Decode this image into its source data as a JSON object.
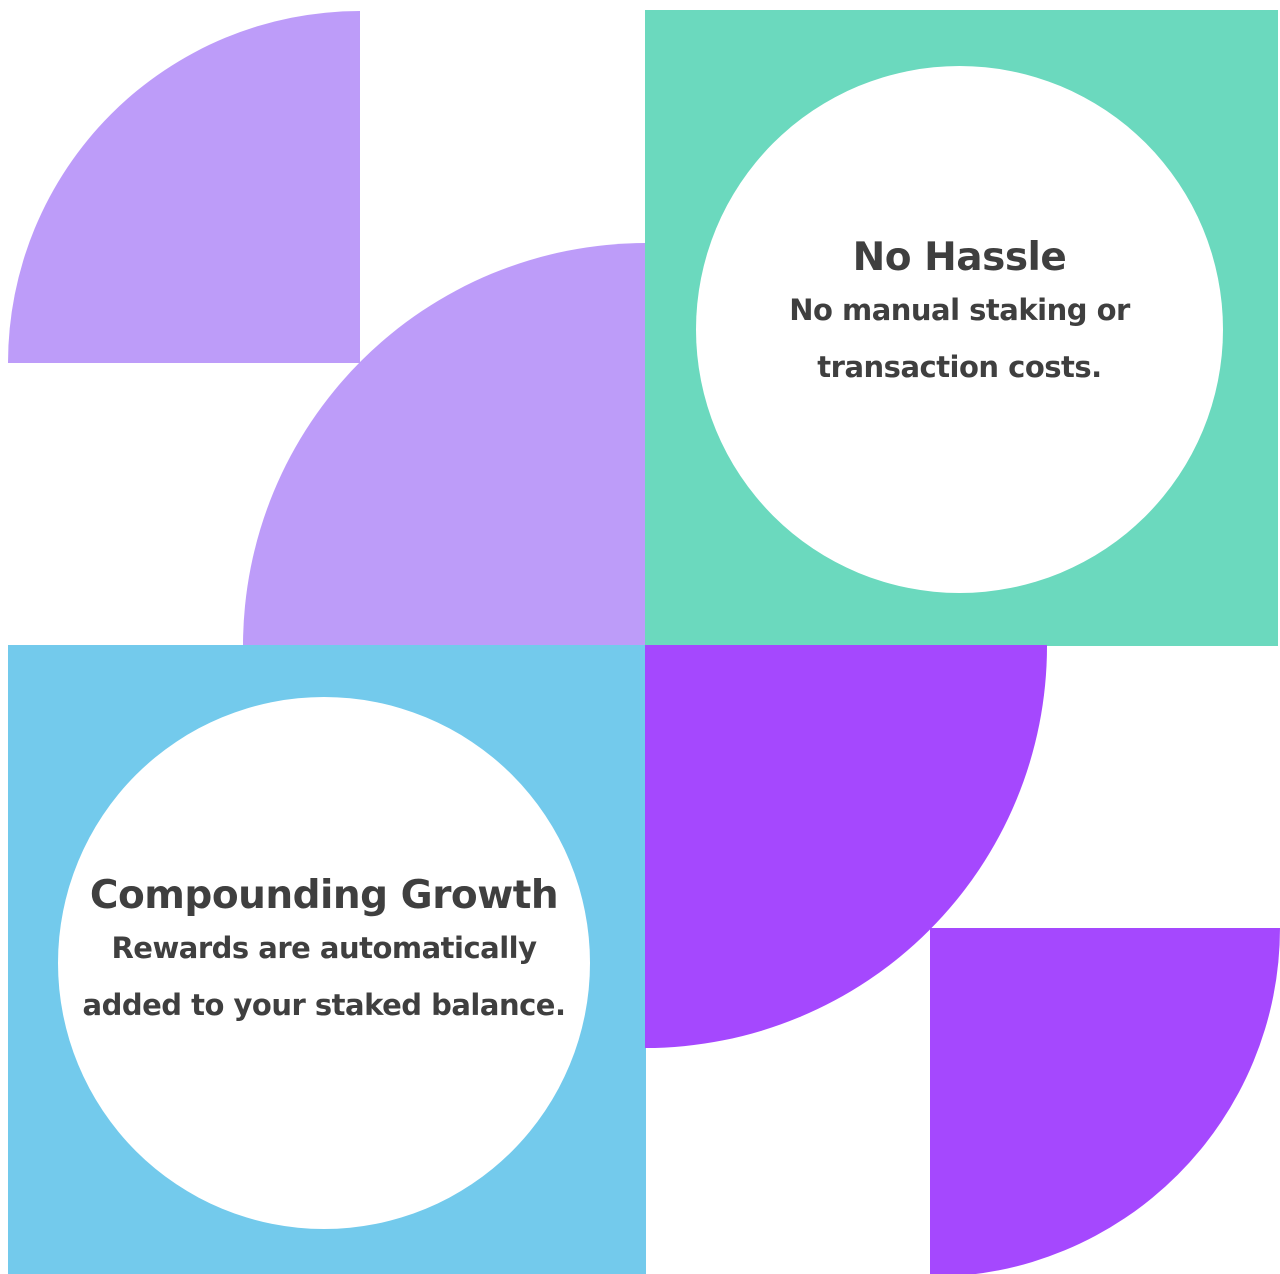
{
  "colors": {
    "lavender": "#bd9cf9",
    "green": "#6bd9be",
    "blue": "#73caec",
    "purple": "#a548fe",
    "white": "#ffffff",
    "text": "#3f3f3f"
  },
  "features": [
    {
      "title": "No Hassle",
      "text": "No manual staking or transaction costs."
    },
    {
      "title": "Compounding Growth",
      "text": "Rewards are automatically added to your staked balance."
    }
  ]
}
